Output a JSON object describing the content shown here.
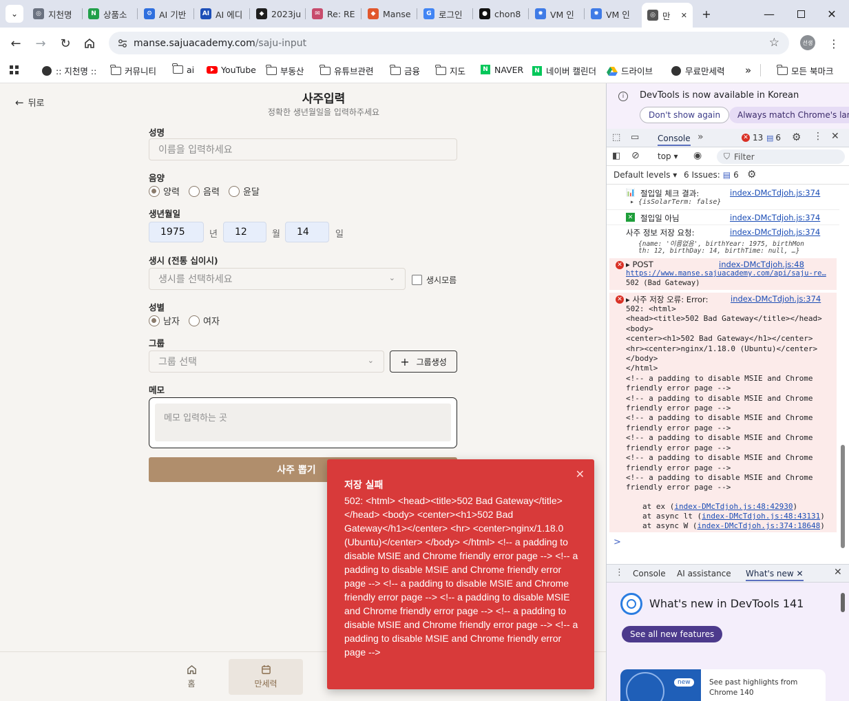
{
  "browser": {
    "tabs": [
      {
        "label": "지천명",
        "color": "#6b7280",
        "glyph": "◎"
      },
      {
        "label": "상품소",
        "color": "#22a04a",
        "glyph": "N"
      },
      {
        "label": "AI 기반",
        "color": "#2f6fde",
        "glyph": "⚙"
      },
      {
        "label": "AI 에디",
        "color": "#1d4fb8",
        "glyph": "AI"
      },
      {
        "label": "2023ju",
        "color": "#1e1e1e",
        "glyph": "◆"
      },
      {
        "label": "Re: RE",
        "color": "#c74b6c",
        "glyph": "✉"
      },
      {
        "label": "Manse",
        "color": "#e1572c",
        "glyph": "◆"
      },
      {
        "label": "로그인",
        "color": "#4285f4",
        "glyph": "G"
      },
      {
        "label": "chon8",
        "color": "#111111",
        "glyph": "●"
      },
      {
        "label": "VM 인",
        "color": "#3f7be6",
        "glyph": "✹"
      },
      {
        "label": "VM 인",
        "color": "#3f7be6",
        "glyph": "✹"
      },
      {
        "label": "만",
        "color": "#555555",
        "glyph": "◎"
      }
    ],
    "new_tab": "+",
    "url_host": "manse.sajuacademy.com",
    "url_path": "/saju-input",
    "profile": "선생",
    "bookmarks": [
      {
        "label": ":: 지천명 ::",
        "icon": "globe-icon"
      },
      {
        "label": "커뮤니티",
        "icon": "folder-icon"
      },
      {
        "label": "ai",
        "icon": "folder-icon"
      },
      {
        "label": "YouTube",
        "icon": "youtube-icon"
      },
      {
        "label": "부동산",
        "icon": "folder-icon"
      },
      {
        "label": "유튜브관련",
        "icon": "folder-icon"
      },
      {
        "label": "금융",
        "icon": "folder-icon"
      },
      {
        "label": "지도",
        "icon": "folder-icon"
      },
      {
        "label": "NAVER",
        "icon": "naver-icon"
      },
      {
        "label": "네이버 캘린더",
        "icon": "naver-icon"
      },
      {
        "label": "드라이브",
        "icon": "drive-icon"
      },
      {
        "label": "무료만세력",
        "icon": "globe-icon"
      }
    ],
    "bookmarks_more": "»",
    "all_bookmarks": "모든 북마크"
  },
  "page": {
    "back_label": "뒤로",
    "title": "사주입력",
    "subtitle": "정확한 생년월일을 입력하주세요",
    "name_label": "성명",
    "name_placeholder": "이름을 입력하세요",
    "calendar_label": "음양",
    "calendar_options": [
      "양력",
      "음력",
      "윤달"
    ],
    "calendar_selected": "양력",
    "birth_label": "생년월일",
    "year": "1975",
    "year_unit": "년",
    "month": "12",
    "month_unit": "월",
    "day": "14",
    "day_unit": "일",
    "time_label": "생시 (전통 십이시)",
    "time_placeholder": "생시를 선택하세요",
    "time_unknown": "생시모름",
    "gender_label": "성별",
    "gender_options": [
      "남자",
      "여자"
    ],
    "gender_selected": "남자",
    "group_label": "그룹",
    "group_placeholder": "그룹 선택",
    "group_create": "그룹생성",
    "memo_label": "메모",
    "memo_placeholder": "메모 입력하는 곳",
    "submit": "사주 뽑기",
    "nav": [
      {
        "label": "홈",
        "icon": "home-icon"
      },
      {
        "label": "만세력",
        "icon": "calendar-icon"
      }
    ]
  },
  "toast": {
    "title": "저장 실패",
    "message": "502: <html> <head><title>502 Bad Gateway</title></head> <body> <center><h1>502 Bad Gateway</h1></center> <hr> <center>nginx/1.18.0 (Ubuntu)</center> </body> </html> <!-- a padding to disable MSIE and Chrome friendly error page --> <!-- a padding to disable MSIE and Chrome friendly error page --> <!-- a padding to disable MSIE and Chrome friendly error page --> <!-- a padding to disable MSIE and Chrome friendly error page --> <!-- a padding to disable MSIE and Chrome friendly error page --> <!-- a padding to disable MSIE and Chrome friendly error page -->"
  },
  "devtools": {
    "banner": "DevTools is now available in Korean",
    "dont_show": "Don't show again",
    "always_match": "Always match Chrome's langu",
    "console_tab": "Console",
    "error_count": "13",
    "msg_count": "6",
    "context": "top",
    "filter_placeholder": "Filter",
    "default_levels": "Default levels",
    "issues_label": "6 Issues:",
    "issues_count": "6",
    "log1_text": "절입일 체크 결과:",
    "log1_src": "index-DMcTdjoh.js:374",
    "log1_obj": "{isSolarTerm: false}",
    "log2_text": "절입일 아님",
    "log2_src": "index-DMcTdjoh.js:374",
    "log3_text": "사주 정보 저장 요청:",
    "log3_src": "index-DMcTdjoh.js:374",
    "log3_obj_1": "{name: '이름없음', birthYear: 1975, birthMon",
    "log3_obj_2": "th: 12, birthDay: 14, birthTime: null, …}",
    "err1_method": "POST",
    "err1_src": "index-DMcTdjoh.js:48",
    "err1_url": "https://www.manse.sajuacademy.com/api/saju-re…",
    "err1_status": "502 (Bad Gateway)",
    "err2_text": "사주 저장 오류: Error:",
    "err2_src": "index-DMcTdjoh.js:374",
    "err2_body": "502: <html>\n<head><title>502 Bad Gateway</title></head>\n<body>\n<center><h1>502 Bad Gateway</h1></center>\n<hr><center>nginx/1.18.0 (Ubuntu)</center>\n</body>\n</html>\n<!-- a padding to disable MSIE and Chrome\nfriendly error page -->\n<!-- a padding to disable MSIE and Chrome\nfriendly error page -->\n<!-- a padding to disable MSIE and Chrome\nfriendly error page -->\n<!-- a padding to disable MSIE and Chrome\nfriendly error page -->\n<!-- a padding to disable MSIE and Chrome\nfriendly error page -->\n<!-- a padding to disable MSIE and Chrome\nfriendly error page -->",
    "stack1_pre": "at ex (",
    "stack1_link": "index-DMcTdjoh.js:48:42930",
    "stack1_post": ")",
    "stack2_pre": "at async lt (",
    "stack2_link": "index-DMcTdjoh.js:48:43131",
    "stack2_post": ")",
    "stack3_pre": "at async W (",
    "stack3_link": "index-DMcTdjoh.js:374:18648",
    "stack3_post": ")",
    "prompt": ">",
    "drawer_tabs": [
      "Console",
      "AI assistance",
      "What's new"
    ],
    "whatsnew_title": "What's new in DevTools 141",
    "see_all": "See all new features",
    "new_badge": "new",
    "past_highlights": "See past highlights from Chrome 140"
  }
}
